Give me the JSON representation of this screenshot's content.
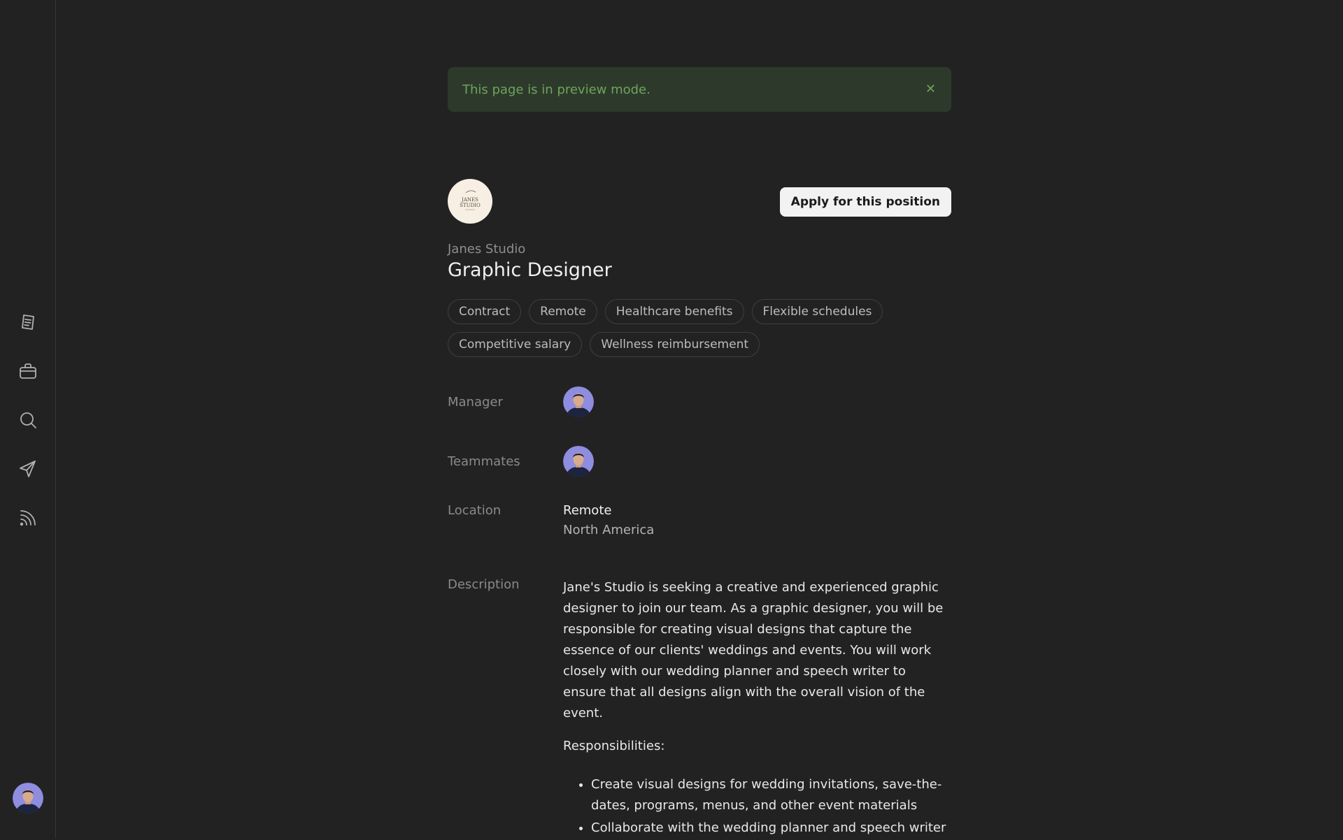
{
  "sidebar": {
    "items": [
      {
        "name": "documents",
        "icon": "document-icon"
      },
      {
        "name": "jobs",
        "icon": "briefcase-icon"
      },
      {
        "name": "search",
        "icon": "search-icon"
      },
      {
        "name": "messages",
        "icon": "send-icon"
      },
      {
        "name": "feed",
        "icon": "rss-icon"
      }
    ]
  },
  "banner": {
    "text": "This page is in preview mode.",
    "close_icon": "close-icon",
    "color": "#6fa35d"
  },
  "job": {
    "company": "Janes Studio",
    "logo_text_line1": "JANES",
    "logo_text_line2": "STUDIO",
    "title": "Graphic Designer",
    "apply_label": "Apply for this position",
    "tags": [
      "Contract",
      "Remote",
      "Healthcare benefits",
      "Flexible schedules",
      "Competitive salary",
      "Wellness reimbursement"
    ]
  },
  "details": {
    "manager_label": "Manager",
    "teammates_label": "Teammates",
    "location_label": "Location",
    "location_primary": "Remote",
    "location_secondary": "North America",
    "description_label": "Description",
    "description": "Jane's Studio is seeking a creative and experienced graphic designer to join our team. As a graphic designer, you will be responsible for creating visual designs that capture the essence of our clients' weddings and events. You will work closely with our wedding planner and speech writer to ensure that all designs align with the overall vision of the event.",
    "responsibilities_heading": "Responsibilities:",
    "responsibilities": [
      "Create visual designs for wedding invitations, save-the-dates, programs, menus, and other event materials",
      "Collaborate with the wedding planner and speech writer"
    ]
  }
}
